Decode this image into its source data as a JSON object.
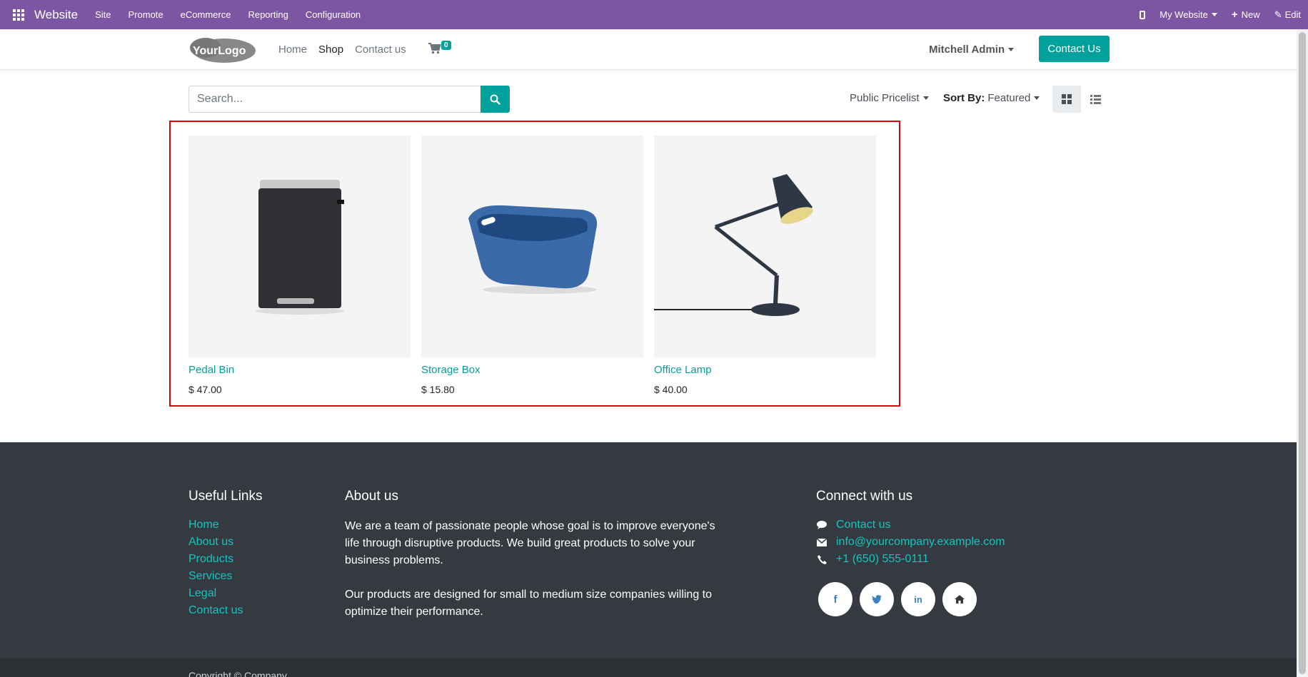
{
  "adminbar": {
    "brand": "Website",
    "menus": [
      "Site",
      "Promote",
      "eCommerce",
      "Reporting",
      "Configuration"
    ],
    "website_selector": "My Website",
    "new_label": "New",
    "edit_label": "Edit"
  },
  "header": {
    "logo_text": "YourLogo",
    "nav": [
      "Home",
      "Shop",
      "Contact us"
    ],
    "active_nav": "Shop",
    "cart_count": "0",
    "user": "Mitchell Admin",
    "contact_button": "Contact Us"
  },
  "shop": {
    "search_placeholder": "Search...",
    "pricelist": "Public Pricelist",
    "sort_label": "Sort By:",
    "sort_value": "Featured",
    "products": [
      {
        "name": "Pedal Bin",
        "price": "$ 47.00"
      },
      {
        "name": "Storage Box",
        "price": "$ 15.80"
      },
      {
        "name": "Office Lamp",
        "price": "$ 40.00"
      }
    ]
  },
  "footer": {
    "useful_links_title": "Useful Links",
    "useful_links": [
      "Home",
      "About us",
      "Products",
      "Services",
      "Legal",
      "Contact us"
    ],
    "about_title": "About us",
    "about_p1": "We are a team of passionate people whose goal is to improve everyone's life through disruptive products. We build great products to solve your business problems.",
    "about_p2": "Our products are designed for small to medium size companies willing to optimize their performance.",
    "connect_title": "Connect with us",
    "connect_contact": "Contact us",
    "connect_email": "info@yourcompany.example.com",
    "connect_phone": "+1 (650) 555-0111",
    "copyright": "Copyright © Company"
  },
  "colors": {
    "admin_purple": "#7c55a3",
    "primary_teal": "#00a09d",
    "footer_bg": "#343a40",
    "footer_link": "#11c6c0",
    "highlight_red": "#e00000"
  }
}
